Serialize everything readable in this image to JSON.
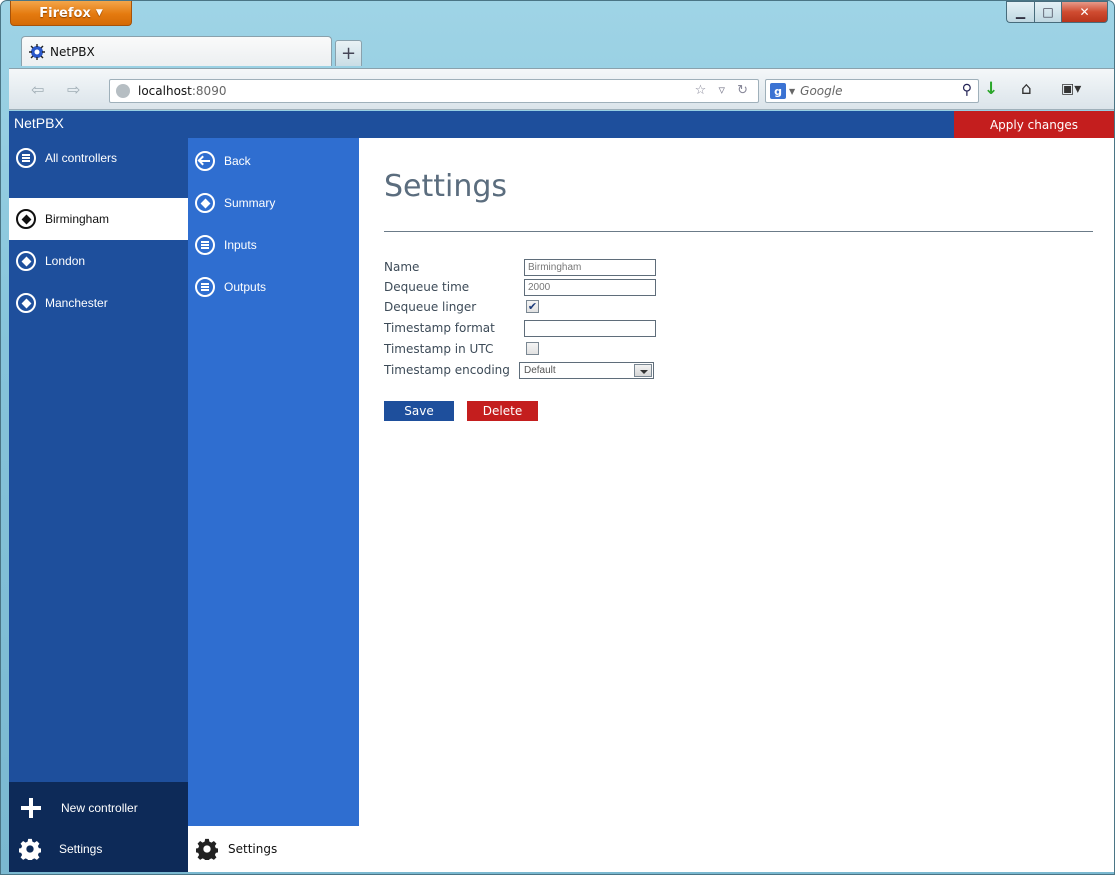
{
  "browser": {
    "menu_button": "Firefox",
    "tab_title": "NetPBX",
    "url_host": "localhost",
    "url_port": ":8090",
    "search_placeholder": "Google"
  },
  "app": {
    "brand": "NetPBX",
    "apply_label": "Apply changes"
  },
  "sidebar": {
    "all_controllers": "All controllers",
    "controllers": [
      "Birmingham",
      "London",
      "Manchester"
    ],
    "new_controller": "New controller",
    "settings": "Settings"
  },
  "subnav": {
    "items": [
      "Back",
      "Summary",
      "Inputs",
      "Outputs"
    ],
    "settings": "Settings"
  },
  "content": {
    "title": "Settings",
    "fields": {
      "name_label": "Name",
      "name_value": "Birmingham",
      "dequeue_time_label": "Dequeue time",
      "dequeue_time_value": "2000",
      "dequeue_linger_label": "Dequeue linger",
      "dequeue_linger_checked": true,
      "timestamp_format_label": "Timestamp format",
      "timestamp_format_value": "",
      "timestamp_utc_label": "Timestamp in UTC",
      "timestamp_utc_checked": false,
      "timestamp_encoding_label": "Timestamp encoding",
      "timestamp_encoding_value": "Default"
    },
    "save_label": "Save",
    "delete_label": "Delete"
  },
  "colors": {
    "primary": "#1e4f9c",
    "secondary": "#2f6ed0",
    "dark": "#0d2a58",
    "danger": "#c41e1e"
  }
}
